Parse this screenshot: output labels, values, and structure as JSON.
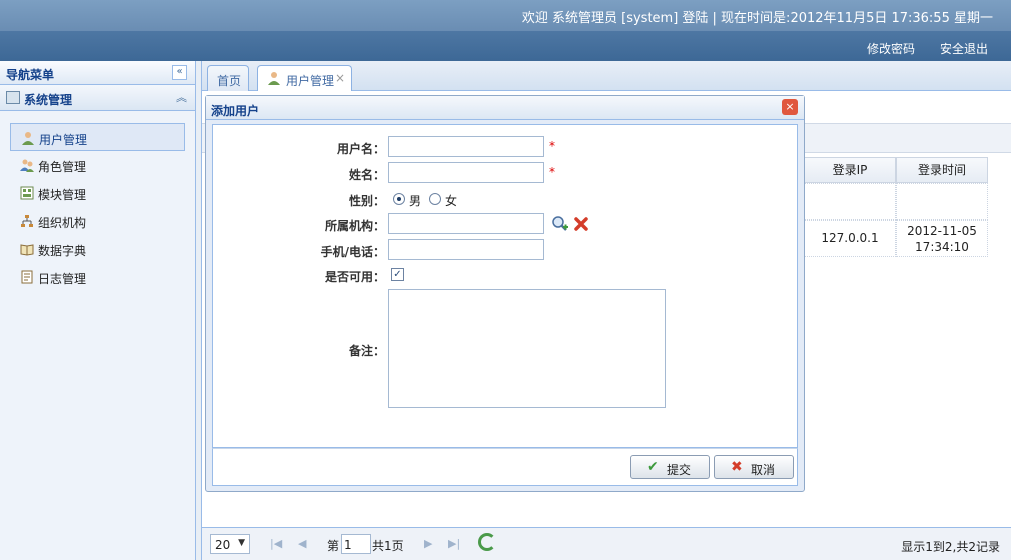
{
  "header": {
    "welcome": "欢迎 系统管理员 [system] 登陆 | 现在时间是:2012年11月5日 17:36:55 星期一",
    "change_password": "修改密码",
    "logout": "安全退出"
  },
  "nav": {
    "title": "导航菜单",
    "collapse": "«",
    "section": "系统管理",
    "section_toggle": "︽",
    "items": [
      {
        "label": "用户管理",
        "icon": "user-icon"
      },
      {
        "label": "角色管理",
        "icon": "users-icon"
      },
      {
        "label": "模块管理",
        "icon": "module-icon"
      },
      {
        "label": "组织机构",
        "icon": "org-icon"
      },
      {
        "label": "数据字典",
        "icon": "book-icon"
      },
      {
        "label": "日志管理",
        "icon": "log-icon"
      }
    ]
  },
  "tabs": [
    {
      "label": "首页"
    },
    {
      "label": "用户管理",
      "close": "×"
    }
  ],
  "grid": {
    "headers": [
      "登录IP",
      "登录时间"
    ],
    "rows": [
      {
        "ip": "",
        "time": ""
      },
      {
        "ip": "127.0.0.1",
        "time_date": "2012-11-05",
        "time_clock": "17:34:10"
      }
    ]
  },
  "pager": {
    "page_size": "20",
    "page_prefix": "第",
    "page_value": "1",
    "page_total": "共1页",
    "info": "显示1到2,共2记录"
  },
  "dialog": {
    "title": "添加用户",
    "close": "×",
    "fields": {
      "username": "用户名：",
      "name": "姓名：",
      "gender": "性别：",
      "org": "所属机构：",
      "phone": "手机/电话：",
      "enabled": "是否可用：",
      "remark": "备注："
    },
    "required_mark": "*",
    "gender_male": "男",
    "gender_female": "女",
    "checkbox_mark": "✓",
    "submit": "提交",
    "cancel": "取消",
    "submit_icon": "✔",
    "cancel_icon": "✖"
  },
  "colors": {
    "accent": "#15428b",
    "border": "#99bbe8",
    "required": "#dd0000"
  }
}
